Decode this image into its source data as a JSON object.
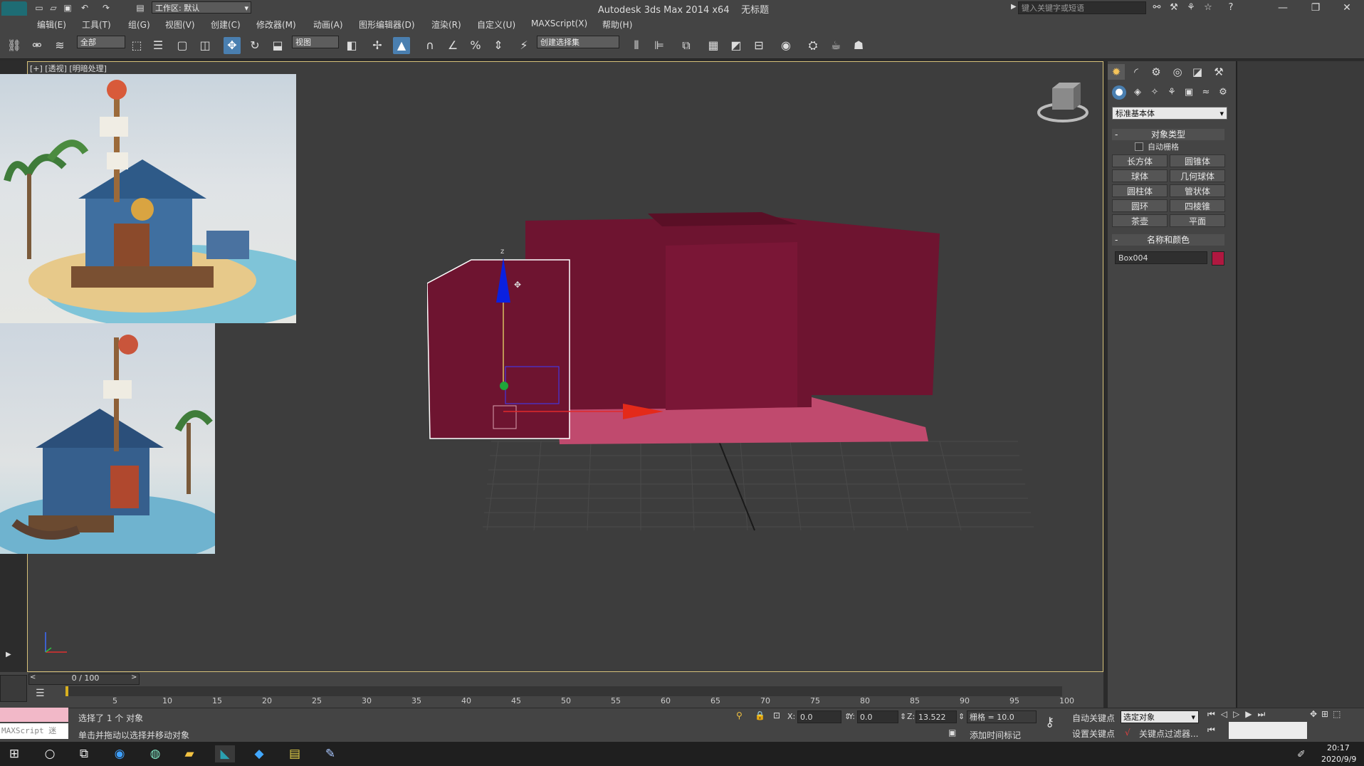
{
  "title_bar": {
    "workspace": "工作区: 默认",
    "app_title": "Autodesk 3ds Max  2014 x64",
    "doc_title": "无标题",
    "search_placeholder": "键入关键字或短语"
  },
  "menu": [
    "编辑(E)",
    "工具(T)",
    "组(G)",
    "视图(V)",
    "创建(C)",
    "修改器(M)",
    "动画(A)",
    "图形编辑器(D)",
    "渲染(R)",
    "自定义(U)",
    "MAXScript(X)",
    "帮助(H)"
  ],
  "toolbar": {
    "selection_filter": "全部",
    "ref_coord": "视图",
    "named_selection": "创建选择集"
  },
  "viewport": {
    "label": "[+] [透视] [明暗处理]",
    "axis_z": "z",
    "object_color": "#6e1430",
    "floor_color": "#c04a6e"
  },
  "command_panel": {
    "category": "标准基本体",
    "object_type_title": "对象类型",
    "auto_grid": "自动栅格",
    "primitives": [
      "长方体",
      "圆锥体",
      "球体",
      "几何球体",
      "圆柱体",
      "管状体",
      "圆环",
      "四棱锥",
      "茶壶",
      "平面"
    ],
    "name_color_title": "名称和颜色",
    "object_name": "Box004",
    "object_color": "#b01840"
  },
  "timeline": {
    "frame": "0 / 100",
    "ticks": [
      "5",
      "10",
      "15",
      "20",
      "25",
      "30",
      "35",
      "40",
      "45",
      "50",
      "55",
      "60",
      "65",
      "70",
      "75",
      "80",
      "85",
      "90",
      "95",
      "100"
    ]
  },
  "status": {
    "maxscript": "MAXScript 迷",
    "selection_info": "选择了 1 个 对象",
    "prompt": "单击并拖动以选择并移动对象",
    "x_label": "X:",
    "x_value": "0.0",
    "y_label": "Y:",
    "y_value": "0.0",
    "z_label": "Z:",
    "z_value": "13.522",
    "grid": "栅格 = 10.0",
    "add_time_tag": "添加时间标记",
    "auto_key": "自动关键点",
    "selected_object": "选定对象",
    "set_key": "设置关键点",
    "key_filters": "关键点过滤器..."
  },
  "taskbar": {
    "time": "20:17",
    "date": "2020/9/9"
  }
}
